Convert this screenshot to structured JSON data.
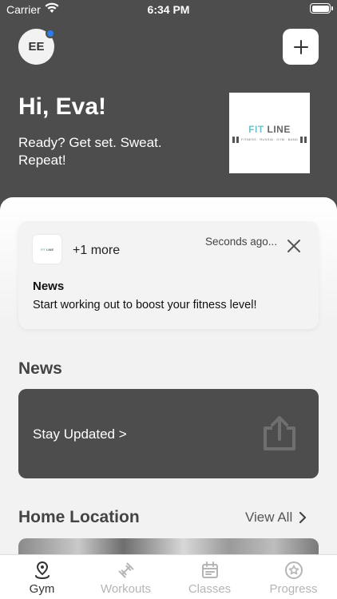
{
  "status_bar": {
    "carrier": "Carrier",
    "time": "6:34 PM"
  },
  "header": {
    "avatar_initials": "EE",
    "greeting": "Hi, Eva!",
    "tagline": "Ready? Get set. Sweat. Repeat!",
    "logo": {
      "fit": "FIT",
      "line": "LINE",
      "sub": "FITNESS · RUSSIA · GYM · BAND"
    }
  },
  "notification": {
    "more": "+1 more",
    "time": "Seconds ago...",
    "title": "News",
    "body": "Start working out to boost your fitness level!"
  },
  "news": {
    "heading": "News",
    "card_label": "Stay Updated >"
  },
  "home_location": {
    "heading": "Home Location",
    "view_all": "View All"
  },
  "tabs": [
    {
      "label": "Gym",
      "icon": "location-pin-icon",
      "active": true
    },
    {
      "label": "Workouts",
      "icon": "dumbbell-icon",
      "active": false
    },
    {
      "label": "Classes",
      "icon": "calendar-icon",
      "active": false
    },
    {
      "label": "Progress",
      "icon": "star-badge-icon",
      "active": false
    }
  ],
  "colors": {
    "header_bg": "#4d4d4d",
    "accent_dot": "#2b7de9",
    "logo_teal": "#6cc3cb"
  }
}
